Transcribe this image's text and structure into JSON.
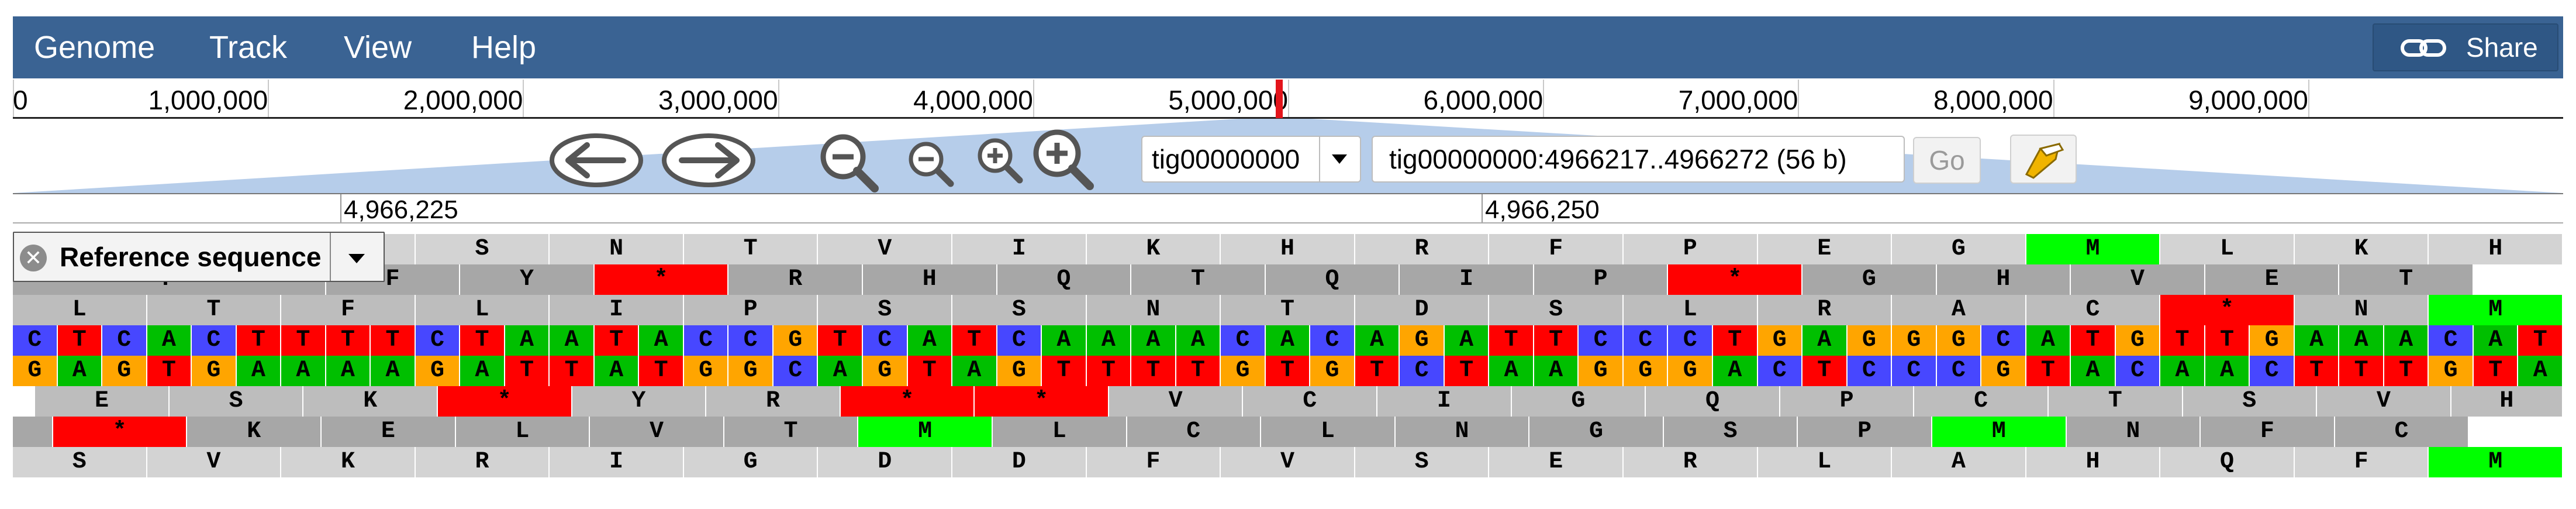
{
  "menu": {
    "items": [
      "Genome",
      "Track",
      "View",
      "Help"
    ],
    "share_label": "Share"
  },
  "overview": {
    "labels": [
      "0",
      "1,000,000",
      "2,000,000",
      "3,000,000",
      "4,000,000",
      "5,000,000",
      "6,000,000",
      "7,000,000",
      "8,000,000",
      "9,000,000"
    ]
  },
  "navigation": {
    "sequence_select": "tig00000000",
    "location": "tig00000000:4966217..4966272 (56 b)",
    "go_label": "Go"
  },
  "ruler": {
    "labels": [
      "4,966,225",
      "4,966,250"
    ]
  },
  "track": {
    "label": "Reference sequence",
    "forward_frames": [
      "SNTVIKHRFPEGMLKH",
      "FY*RHQTQIP*GHVET",
      "LTFLIPSSNTDSLRAC*NM"
    ],
    "forward_frame_first_partial": [
      "",
      "F",
      "L"
    ],
    "forward_dna": "CTCACTTTTCTAATACCGTCATCAAAACACAGATTCCCTGAGGGCATGTTGAAACAT",
    "reverse_dna": "GAGTGAAAAGATTATGGCAGTAGTTTTGTGTCTAAGGGACTCCCGTACAACTTTGTA",
    "reverse_frames": [
      "ESK*YR**VCIGQPCTSVH",
      "*KELVTMLCLNGSPMNFC",
      "SVKRIGDDFVSERLAHQFM"
    ],
    "colors": {
      "A": "#00bf00",
      "C": "#4747ff",
      "G": "#ffa500",
      "T": "#ff0000",
      "stop": "#ff0000",
      "start": "#00ff00",
      "frame_dark": "#bdbdbd",
      "frame_mid": "#a7a7a7",
      "frame_light": "#d3d3d3"
    }
  }
}
